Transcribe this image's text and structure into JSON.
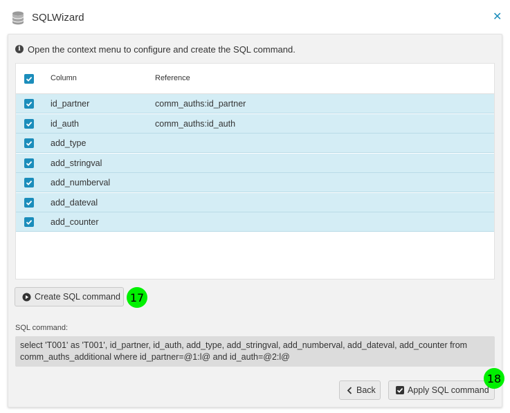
{
  "window": {
    "title": "SQLWizard",
    "icon": "database-icon",
    "close_icon": "close-icon"
  },
  "info": {
    "icon": "info-icon",
    "text": "Open the context menu to configure and create the SQL command."
  },
  "grid": {
    "header_checked": true,
    "columns": [
      "Column",
      "Reference"
    ],
    "rows": [
      {
        "checked": true,
        "column": "id_partner",
        "reference": "comm_auths:id_partner"
      },
      {
        "checked": true,
        "column": "id_auth",
        "reference": "comm_auths:id_auth"
      },
      {
        "checked": true,
        "column": "add_type",
        "reference": ""
      },
      {
        "checked": true,
        "column": "add_stringval",
        "reference": ""
      },
      {
        "checked": true,
        "column": "add_numberval",
        "reference": ""
      },
      {
        "checked": true,
        "column": "add_dateval",
        "reference": ""
      },
      {
        "checked": true,
        "column": "add_counter",
        "reference": ""
      }
    ]
  },
  "actions": {
    "create_label": "Create SQL command",
    "create_icon": "play-circle-icon",
    "create_badge": "17",
    "back_label": "Back",
    "back_icon": "chevron-left-icon",
    "apply_label": "Apply SQL command",
    "apply_icon": "check-square-icon",
    "apply_badge": "18"
  },
  "sql": {
    "label": "SQL command:",
    "line1": "select 'T001' as 'T001', id_partner, id_auth, add_type, add_stringval, add_numberval, add_dateval, add_counter from",
    "line2": "comm_auths_additional where id_partner=@1:l@ and id_auth=@2:l@"
  },
  "colors": {
    "accent": "#1b8dbb",
    "row_selected": "#d4edf5",
    "badge": "#00f000"
  }
}
